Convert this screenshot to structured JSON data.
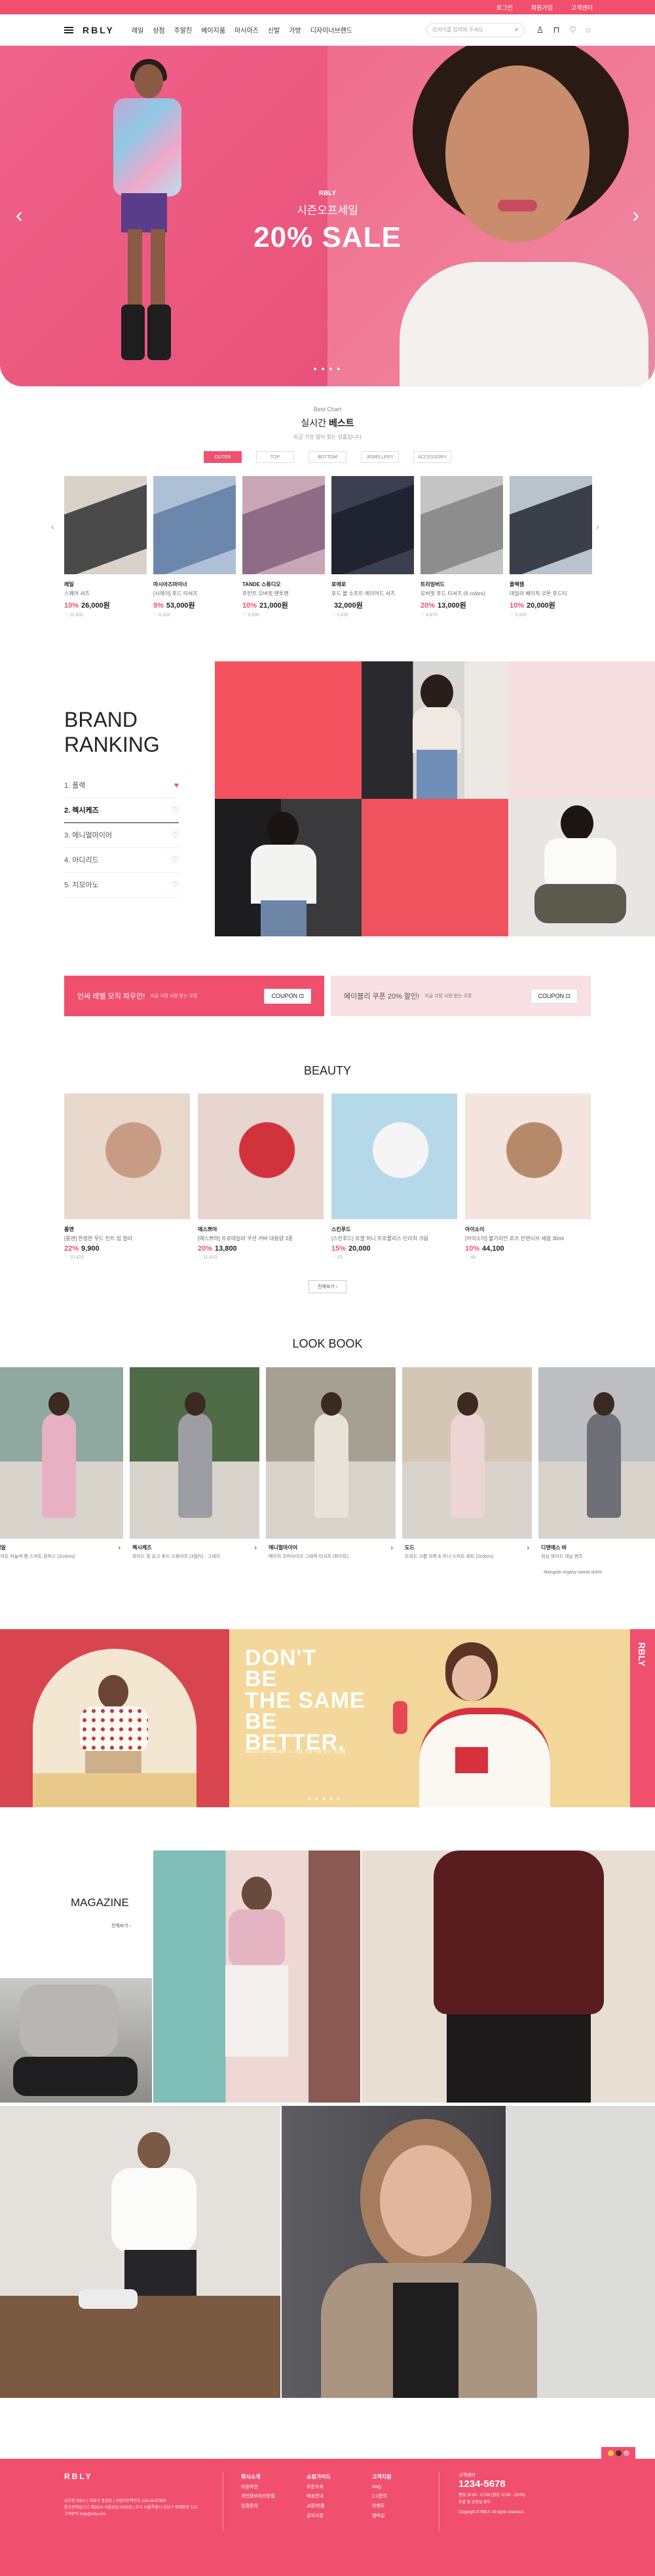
{
  "topbar": {
    "links": [
      "로그인",
      "회원가입",
      "고객센터"
    ]
  },
  "header": {
    "logo": "RBLY",
    "nav": [
      "레일",
      "상점",
      "주말진",
      "베이지룸",
      "마시아즈",
      "신발",
      "가방",
      "디자이너브랜드"
    ],
    "search_placeholder": "검색어를 입력해 주세요"
  },
  "hero": {
    "small": "RBLY",
    "season": "시즌오프세일",
    "headline": "20% SALE",
    "dots": "● ● ● ●"
  },
  "best": {
    "sub": "Best Chart",
    "title_a": "실시간",
    "title_b": "베스트",
    "desc": "지금 가장 많이 찾는 상품입니다",
    "tabs": [
      "OUTER",
      "TOP",
      "BOTTOM",
      "JEWELLERY",
      "ACCESSORY"
    ],
    "products": [
      {
        "brand": "레일",
        "name": "스퀘어 셔츠",
        "dc": "10%",
        "price": "26,000원",
        "likes": "♡ 11,400",
        "c1": "#4a4a4a",
        "c2": "#d8d2c8"
      },
      {
        "brand": "마시아즈마이너",
        "name": "[시레이] 후드 티셔츠",
        "dc": "9%",
        "price": "53,000원",
        "likes": "♡ 6,320",
        "c1": "#6b88ac",
        "c2": "#aec0d6"
      },
      {
        "brand": "TANDE 스튜디오",
        "name": "프린트 오버핏 맨투맨",
        "dc": "10%",
        "price": "21,000원",
        "likes": "♡ 5,690",
        "c1": "#8f6c85",
        "c2": "#c9a6b6"
      },
      {
        "brand": "로에로",
        "name": "후드 볼 소프트 레이어드 셔츠",
        "dc": "",
        "price": "32,000원",
        "likes": "♡ 2,430",
        "c1": "#1f2430",
        "c2": "#3a4050"
      },
      {
        "brand": "트리밍버드",
        "name": "오버핏 후드 티셔츠 (6 colors)",
        "dc": "20%",
        "price": "13,000원",
        "likes": "♡ 4,870",
        "c1": "#8d8d8d",
        "c2": "#c4c4c4"
      },
      {
        "brand": "플랙잼",
        "name": "데일리 베이직 코튼 후드티",
        "dc": "10%",
        "price": "20,000원",
        "likes": "♡ 5,320",
        "c1": "#3a3f4a",
        "c2": "#b9c3cc"
      }
    ]
  },
  "ranking": {
    "title": "BRAND\nRANKING",
    "items": [
      "1. 플랙",
      "2. 렉시케즈",
      "3. 에니멀마이어",
      "4. 아디리드",
      "5. 지모아노"
    ]
  },
  "coupons": [
    {
      "title": "인싸 레벨 모직 파우만!",
      "sub": "지금 가장 사랑 받는 쿠폰",
      "btn": "COUPON ⊡"
    },
    {
      "title": "에이블리 쿠폰 20% 할인!",
      "sub": "지금 가장 사랑 받는 쿠폰",
      "btn": "COUPON ⊡"
    }
  ],
  "beauty": {
    "title": "BEAUTY",
    "items": [
      {
        "brand": "롬앤",
        "name": "[롬앤] 한정판 무드 틴트 립 컬러",
        "dc": "22%",
        "price": "9,900",
        "likes": "♡ 10,420",
        "c1": "#e9d8cc",
        "c2": "#c89c84"
      },
      {
        "brand": "에스쁘아",
        "name": "[에스쁘아] 프로테일러 쿠션 커버 대용량 3종",
        "dc": "20%",
        "price": "13,800",
        "likes": "♡ 11,413",
        "c1": "#e7d5cf",
        "c2": "#d1323b"
      },
      {
        "brand": "스킨푸드",
        "name": "[스킨푸드] 로열 허니 프로폴리스 인리치 크림",
        "dc": "15%",
        "price": "20,000",
        "likes": "♡ 13",
        "c1": "#b6d9ea",
        "c2": "#f5f5f5"
      },
      {
        "brand": "아이소이",
        "name": "[아이소이] 불가리안 로즈 인텐시브 세럼 30ml",
        "dc": "10%",
        "price": "44,100",
        "likes": "♡ 48",
        "c1": "#f3e4dd",
        "c2": "#b58a6a"
      }
    ],
    "more": "전체보기 ›"
  },
  "lookbook": {
    "title": "LOOK BOOK",
    "items": [
      {
        "name": "레일",
        "desc": "데이트 하늘색 롱 스커트 원피스 (2colors)",
        "c1": "#8fa8a0",
        "c2": "#e7b0c3"
      },
      {
        "name": "렉시케즈",
        "desc": "와이드 핏 로고 후드 스웻셔츠 (3컬러) - 그레이",
        "c1": "#4f6b48",
        "c2": "#9c9ea4"
      },
      {
        "name": "에니멀마이어",
        "desc": "베이직 오버사이즈 그래픽 티셔츠 (화이트)",
        "c1": "#a6a093",
        "c2": "#e8e3d8"
      },
      {
        "name": "도드",
        "desc": "트위드 크롭 자켓 & 미니 스커트 세트 (2colors)",
        "c1": "#d4c6b4",
        "c2": "#ecd5d4"
      },
      {
        "name": "디앤에스 바",
        "desc": "워싱 와이드 데님 팬츠",
        "c1": "#bdbec2",
        "c2": "#6f6f78"
      }
    ],
    "extra": "Mangobi organy sweat shirts"
  },
  "promo": {
    "headline": "DON'T\nBE\nTHE SAME\nBE\nBETTER.",
    "small": "Season off collection — 지금 가장 사랑 받는 신상품",
    "dots": "● ● ● ● ●",
    "tab": "RBLY"
  },
  "magazine": {
    "title": "MAGAZINE",
    "more": "전체보기 ›"
  },
  "footer": {
    "logo": "RBLY",
    "info": "상호명 RBLY  |  대표자 홍길동  |  사업자등록번호 123-45-67890\n통신판매업신고 제2024-서울강남-0000호  |  주소 서울특별시 강남구 테헤란로 123\n고객문의 help@rbly.com",
    "cols": [
      {
        "head": "회사소개",
        "items": [
          "이용약관",
          "개인정보처리방침",
          "입점문의"
        ]
      },
      {
        "head": "쇼핑가이드",
        "items": [
          "주문조회",
          "배송안내",
          "교환/반품",
          "공지사항"
        ]
      },
      {
        "head": "고객지원",
        "items": [
          "FAQ",
          "1:1문의",
          "이벤트",
          "멤버십"
        ]
      }
    ],
    "cs_title": "고객센터",
    "phone": "1234-5678",
    "hours": "평일 10:00 - 17:00 (점심 12:00 - 13:00)\n주말 및 공휴일 휴무",
    "copy": "Copyright © RBLY. All rights reserved."
  }
}
